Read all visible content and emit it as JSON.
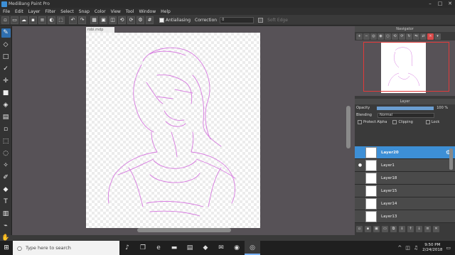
{
  "window": {
    "title": "MediBang Paint Pro",
    "minimize": "–",
    "maximize": "□",
    "close": "✕"
  },
  "menu": [
    "File",
    "Edit",
    "Layer",
    "Filter",
    "Select",
    "Snap",
    "Color",
    "View",
    "Tool",
    "Window",
    "Help"
  ],
  "toolbar": {
    "antialiasing_label": "Antialiasing",
    "correction_label": "Correction",
    "correction_value": "0",
    "soft_edge_label": "Soft Edge"
  },
  "document": {
    "tab_title": "robi.mdp"
  },
  "navigator": {
    "title": "Navigator"
  },
  "layer_panel": {
    "title": "Layer",
    "opacity_label": "Opacity",
    "opacity_value": "100 %",
    "blending_label": "Blending",
    "blending_value": "Normal",
    "protect_alpha": "Protect Alpha",
    "clipping": "Clipping",
    "lock": "Lock",
    "layers": [
      {
        "name": "Layer20",
        "selected": true,
        "visible": true
      },
      {
        "name": "Layer1",
        "selected": false,
        "visible": true
      },
      {
        "name": "Layer18",
        "selected": false,
        "visible": false
      },
      {
        "name": "Layer15",
        "selected": false,
        "visible": false
      },
      {
        "name": "Layer14",
        "selected": false,
        "visible": false
      },
      {
        "name": "Layer13",
        "selected": false,
        "visible": false
      },
      {
        "name": "Layer12",
        "selected": false,
        "visible": false
      }
    ]
  },
  "taskbar": {
    "search_placeholder": "Type here to search",
    "time": "9:50 PM",
    "date": "2/24/2018"
  },
  "colors": {
    "accent": "#3d8fd6",
    "sketch": "#d77be0",
    "navigator_frame": "#e03a3a"
  }
}
